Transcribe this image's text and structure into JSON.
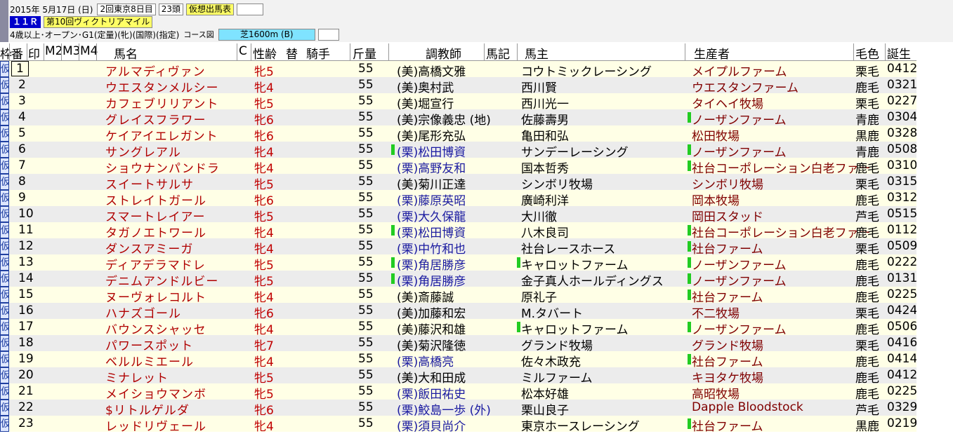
{
  "header": {
    "date": "2015年  5月17日 (日)",
    "meeting": "2回東京8日目",
    "runners": "23頭",
    "card_type": "仮想出馬表",
    "race_no": "１１Ｒ",
    "race_name": "第10回ヴィクトリアマイル",
    "conditions": "4歳以上･オープン･G1(定量)(牝)(国際)(指定)",
    "course_label": "コース図",
    "course": "芝1600m  (B)"
  },
  "columns": {
    "waku": "枠",
    "ban": "番",
    "mark": "印",
    "m2": "M2",
    "m3": "M3",
    "m4": "M4",
    "name": "馬名",
    "c": "C",
    "sexage": "性齢",
    "change": "替",
    "jockey": "騎手",
    "weight": "斤量",
    "trainer": "調教師",
    "horse_mark": "馬記",
    "owner": "馬主",
    "breeder": "生産者",
    "color": "毛色",
    "bday": "誕生"
  },
  "rows": [
    {
      "waku": "仮",
      "no": "1",
      "name": "アルマディヴァン",
      "sexage": "牝5",
      "weight": "55",
      "trainer": "(美)高橋文雅",
      "owner": "コウトミックレーシング",
      "breeder": "メイプルファーム",
      "color": "栗毛",
      "bday": "0412"
    },
    {
      "waku": "仮",
      "no": "2",
      "name": "ウエスタンメルシー",
      "sexage": "牝4",
      "weight": "55",
      "trainer": "(美)奥村武",
      "owner": "西川賢",
      "breeder": "ウエスタンファーム",
      "color": "鹿毛",
      "bday": "0321"
    },
    {
      "waku": "仮",
      "no": "3",
      "name": "カフェブリリアント",
      "sexage": "牝5",
      "weight": "55",
      "trainer": "(美)堀宣行",
      "owner": "西川光一",
      "breeder": "タイヘイ牧場",
      "color": "栗毛",
      "bday": "0227"
    },
    {
      "waku": "仮",
      "no": "4",
      "name": "グレイスフラワー",
      "sexage": "牝6",
      "weight": "55",
      "trainer": "(美)宗像義忠 (地)",
      "owner": "佐藤壽男",
      "breeder": "ノーザンファーム",
      "color": "青鹿",
      "bday": "0304"
    },
    {
      "waku": "仮",
      "no": "5",
      "name": "ケイアイエレガント",
      "sexage": "牝6",
      "weight": "55",
      "trainer": "(美)尾形充弘",
      "owner": "亀田和弘",
      "breeder": "松田牧場",
      "color": "黒鹿",
      "bday": "0328"
    },
    {
      "waku": "仮",
      "no": "6",
      "name": "サングレアル",
      "sexage": "牝4",
      "weight": "55",
      "trainer": "(栗)松田博資",
      "owner": "サンデーレーシング",
      "breeder": "ノーザンファーム",
      "color": "青鹿",
      "bday": "0508"
    },
    {
      "waku": "仮",
      "no": "7",
      "name": "ショウナンパンドラ",
      "sexage": "牝4",
      "weight": "55",
      "trainer": "(栗)高野友和",
      "owner": "国本哲秀",
      "breeder": "社台コーポレーション白老ファー",
      "color": "鹿毛",
      "bday": "0310"
    },
    {
      "waku": "仮",
      "no": "8",
      "name": "スイートサルサ",
      "sexage": "牝5",
      "weight": "55",
      "trainer": "(美)菊川正達",
      "owner": "シンボリ牧場",
      "breeder": "シンボリ牧場",
      "color": "栗毛",
      "bday": "0315"
    },
    {
      "waku": "仮",
      "no": "9",
      "name": "ストレイトガール",
      "sexage": "牝6",
      "weight": "55",
      "trainer": "(栗)藤原英昭",
      "owner": "廣崎利洋",
      "breeder": "岡本牧場",
      "color": "鹿毛",
      "bday": "0312"
    },
    {
      "waku": "仮",
      "no": "10",
      "name": "スマートレイアー",
      "sexage": "牝5",
      "weight": "55",
      "trainer": "(栗)大久保龍",
      "owner": "大川徹",
      "breeder": "岡田スタッド",
      "color": "芦毛",
      "bday": "0515"
    },
    {
      "waku": "仮",
      "no": "11",
      "name": "タガノエトワール",
      "sexage": "牝4",
      "weight": "55",
      "trainer": "(栗)松田博資",
      "owner": "八木良司",
      "breeder": "社台コーポレーション白老ファー",
      "color": "鹿毛",
      "bday": "0112"
    },
    {
      "waku": "仮",
      "no": "12",
      "name": "ダンスアミーガ",
      "sexage": "牝4",
      "weight": "55",
      "trainer": "(栗)中竹和也",
      "owner": "社台レースホース",
      "breeder": "社台ファーム",
      "color": "栗毛",
      "bday": "0509"
    },
    {
      "waku": "仮",
      "no": "13",
      "name": "ディアデラマドレ",
      "sexage": "牝5",
      "weight": "55",
      "trainer": "(栗)角居勝彦",
      "owner": "キャロットファーム",
      "breeder": "ノーザンファーム",
      "color": "鹿毛",
      "bday": "0222"
    },
    {
      "waku": "仮",
      "no": "14",
      "name": "デニムアンドルビー",
      "sexage": "牝5",
      "weight": "55",
      "trainer": "(栗)角居勝彦",
      "owner": "金子真人ホールディングス",
      "breeder": "ノーザンファーム",
      "color": "鹿毛",
      "bday": "0131"
    },
    {
      "waku": "仮",
      "no": "15",
      "name": "ヌーヴォレコルト",
      "sexage": "牝4",
      "weight": "55",
      "trainer": "(美)斎藤誠",
      "owner": "原礼子",
      "breeder": "社台ファーム",
      "color": "鹿毛",
      "bday": "0225"
    },
    {
      "waku": "仮",
      "no": "16",
      "name": "ハナズゴール",
      "sexage": "牝6",
      "weight": "55",
      "trainer": "(美)加藤和宏",
      "owner": "M.タバート",
      "breeder": "不二牧場",
      "color": "栗毛",
      "bday": "0424"
    },
    {
      "waku": "仮",
      "no": "17",
      "name": "バウンスシャッセ",
      "sexage": "牝4",
      "weight": "55",
      "trainer": "(美)藤沢和雄",
      "owner": "キャロットファーム",
      "breeder": "ノーザンファーム",
      "color": "鹿毛",
      "bday": "0506"
    },
    {
      "waku": "仮",
      "no": "18",
      "name": "パワースポット",
      "sexage": "牝7",
      "weight": "55",
      "trainer": "(美)菊沢隆徳",
      "owner": "グランド牧場",
      "breeder": "グランド牧場",
      "color": "栗毛",
      "bday": "0416"
    },
    {
      "waku": "仮",
      "no": "19",
      "name": "ベルルミエール",
      "sexage": "牝4",
      "weight": "55",
      "trainer": "(栗)高橋亮",
      "owner": "佐々木政充",
      "breeder": "社台ファーム",
      "color": "鹿毛",
      "bday": "0414"
    },
    {
      "waku": "仮",
      "no": "20",
      "name": "ミナレット",
      "sexage": "牝5",
      "weight": "55",
      "trainer": "(美)大和田成",
      "owner": "ミルファーム",
      "breeder": "キヨタケ牧場",
      "color": "鹿毛",
      "bday": "0412"
    },
    {
      "waku": "仮",
      "no": "21",
      "name": "メイショウマンボ",
      "sexage": "牝5",
      "weight": "55",
      "trainer": "(栗)飯田祐史",
      "owner": "松本好雄",
      "breeder": "高昭牧場",
      "color": "鹿毛",
      "bday": "0225"
    },
    {
      "waku": "仮",
      "no": "22",
      "name": "$リトルゲルダ",
      "sexage": "牝6",
      "weight": "55",
      "trainer": "(栗)鮫島一歩 (外)",
      "owner": "栗山良子",
      "breeder": "Dapple Bloodstock",
      "color": "芦毛",
      "bday": "0329"
    },
    {
      "waku": "仮",
      "no": "23",
      "name": "レッドリヴェール",
      "sexage": "牝4",
      "weight": "55",
      "trainer": "(栗)須貝尚介",
      "owner": "東京ホースレーシング",
      "breeder": "社台ファーム",
      "color": "黒鹿",
      "bday": "0219"
    }
  ],
  "flags": {
    "trainer": [
      6,
      11,
      13,
      14
    ],
    "owner": [
      13,
      17
    ],
    "breeder": [
      4,
      6,
      7,
      11,
      12,
      13,
      14,
      15,
      17,
      19,
      23
    ]
  },
  "colors": {
    "name": "#b00000",
    "ritto_trainer": "#1a1aa0",
    "breeder": "#800000",
    "race_no_bg": "#0000cc",
    "flag": "#22cc22"
  }
}
